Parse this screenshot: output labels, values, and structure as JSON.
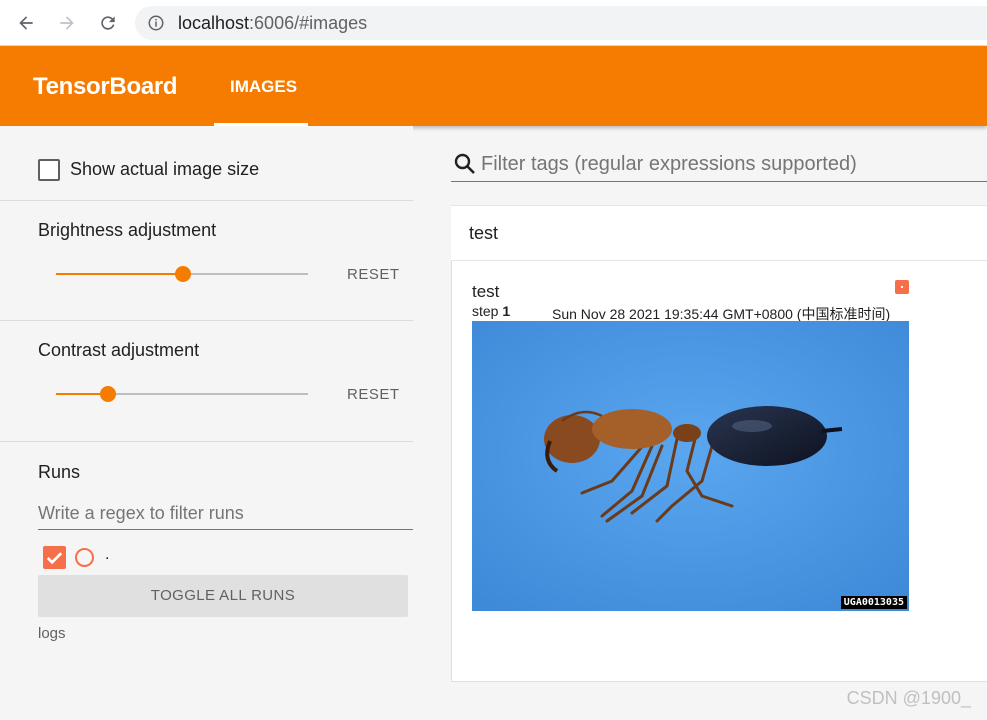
{
  "browser": {
    "url_host": "localhost",
    "url_rest": ":6006/#images"
  },
  "header": {
    "app_title": "TensorBoard",
    "active_tab": "IMAGES",
    "bg_color": "#f57c00"
  },
  "sidebar": {
    "show_actual_size_label": "Show actual image size",
    "show_actual_size_checked": false,
    "brightness": {
      "label": "Brightness adjustment",
      "reset_label": "RESET",
      "value": 0.5
    },
    "contrast": {
      "label": "Contrast adjustment",
      "reset_label": "RESET",
      "value": 0.2
    },
    "runs": {
      "title": "Runs",
      "filter_placeholder": "Write a regex to filter runs",
      "items": [
        {
          "name": ".",
          "checked": true,
          "color": "#f5704a"
        }
      ],
      "toggle_all_label": "TOGGLE ALL RUNS",
      "logdir": "logs"
    }
  },
  "main": {
    "filter_placeholder": "Filter tags (regular expressions supported)",
    "tag_group": "test",
    "card": {
      "title": "test",
      "step_label": "step",
      "step_value": "1",
      "timestamp": "Sun Nov 28 2021 19:35:44 GMT+0800 (中国标准时间)",
      "image_watermark": "UGA0013035"
    }
  },
  "watermark": "CSDN @1900_"
}
